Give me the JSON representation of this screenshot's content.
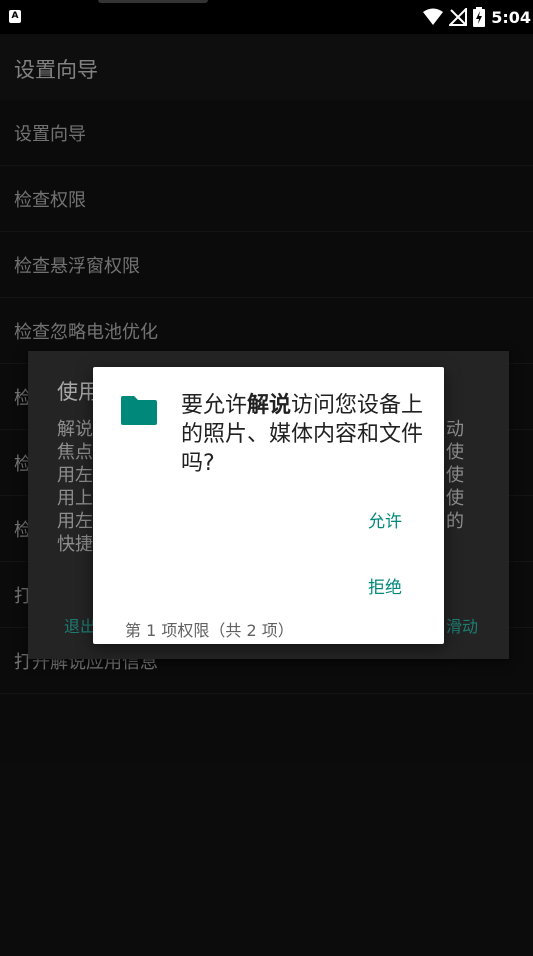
{
  "status_bar": {
    "time": "5:04",
    "app_badge": "A"
  },
  "app_bar": {
    "title": "设置向导"
  },
  "list": {
    "items": [
      "设置向导",
      "检查权限",
      "检查悬浮窗权限",
      "检查忽略电池优化",
      "检",
      "检",
      "检",
      "打",
      "打开解说应用信息"
    ]
  },
  "background_dialog": {
    "title": "使用",
    "body_lines": [
      "解说",
      "焦点",
      "用左",
      "用上",
      "用左",
      "快捷"
    ],
    "right_fragments": [
      "动",
      "使",
      "使",
      "使",
      "的"
    ],
    "btn_left": "退出",
    "btn_right": "滑动"
  },
  "permission_dialog": {
    "icon": "folder-icon",
    "msg_before": "要允许",
    "app_name": "解说",
    "msg_after": "访问您设备上的照片、媒体内容和文件吗?",
    "allow_label": "允许",
    "deny_label": "拒绝",
    "count_text": "第 1 项权限（共 2 项）",
    "accent": "#00897b",
    "icon_color": "#00897b"
  }
}
